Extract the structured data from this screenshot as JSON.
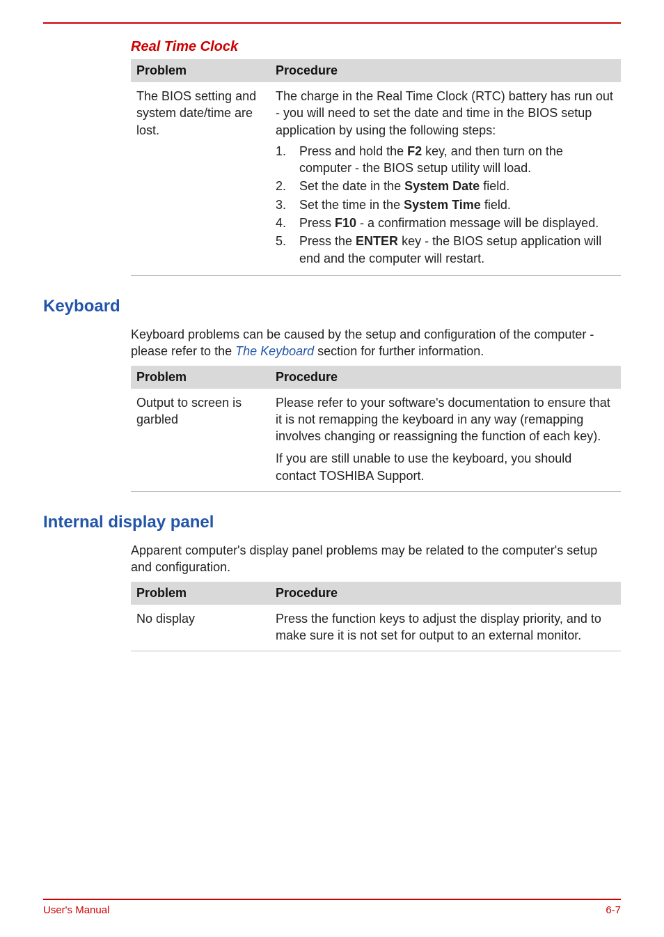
{
  "sections": {
    "rtc": {
      "title": "Real Time Clock",
      "headers": {
        "problem": "Problem",
        "procedure": "Procedure"
      },
      "row": {
        "problem": "The BIOS setting and system date/time are lost.",
        "procedure_intro": "The charge in the Real Time Clock (RTC) battery has run out - you will need to set the date and time in the BIOS setup application by using the following steps:",
        "steps": [
          {
            "n": "1.",
            "pre": "Press and hold the ",
            "bold": "F2",
            "post": " key, and then turn on the computer - the BIOS setup utility will load."
          },
          {
            "n": "2.",
            "pre": "Set the date in the ",
            "bold": "System Date",
            "post": " field."
          },
          {
            "n": "3.",
            "pre": "Set the time in the ",
            "bold": "System Time",
            "post": " field."
          },
          {
            "n": "4.",
            "pre": "Press ",
            "bold": "F10",
            "post": " - a confirmation message will be displayed."
          },
          {
            "n": "5.",
            "pre": "Press the ",
            "bold": "ENTER",
            "post": " key - the BIOS setup application will end and the computer will restart."
          }
        ]
      }
    },
    "keyboard": {
      "title": "Keyboard",
      "intro_pre": "Keyboard problems can be caused by the setup and configuration of the computer - please refer to the ",
      "intro_link": "The Keyboard",
      "intro_post": " section for further information.",
      "headers": {
        "problem": "Problem",
        "procedure": "Procedure"
      },
      "row": {
        "problem": "Output to screen is garbled",
        "procedure_p1": "Please refer to your software's documentation to ensure that it is not remapping the keyboard in any way (remapping involves changing or reassigning the function of each key).",
        "procedure_p2": "If you are still unable to use the keyboard, you should contact TOSHIBA Support."
      }
    },
    "display": {
      "title": "Internal display panel",
      "intro": "Apparent computer's display panel problems may be related to the computer's setup and configuration.",
      "headers": {
        "problem": "Problem",
        "procedure": "Procedure"
      },
      "row": {
        "problem": "No display",
        "procedure": "Press the function keys to adjust the display priority, and to make sure it is not set for output to an external monitor."
      }
    }
  },
  "footer": {
    "left": "User's Manual",
    "right": "6-7"
  }
}
